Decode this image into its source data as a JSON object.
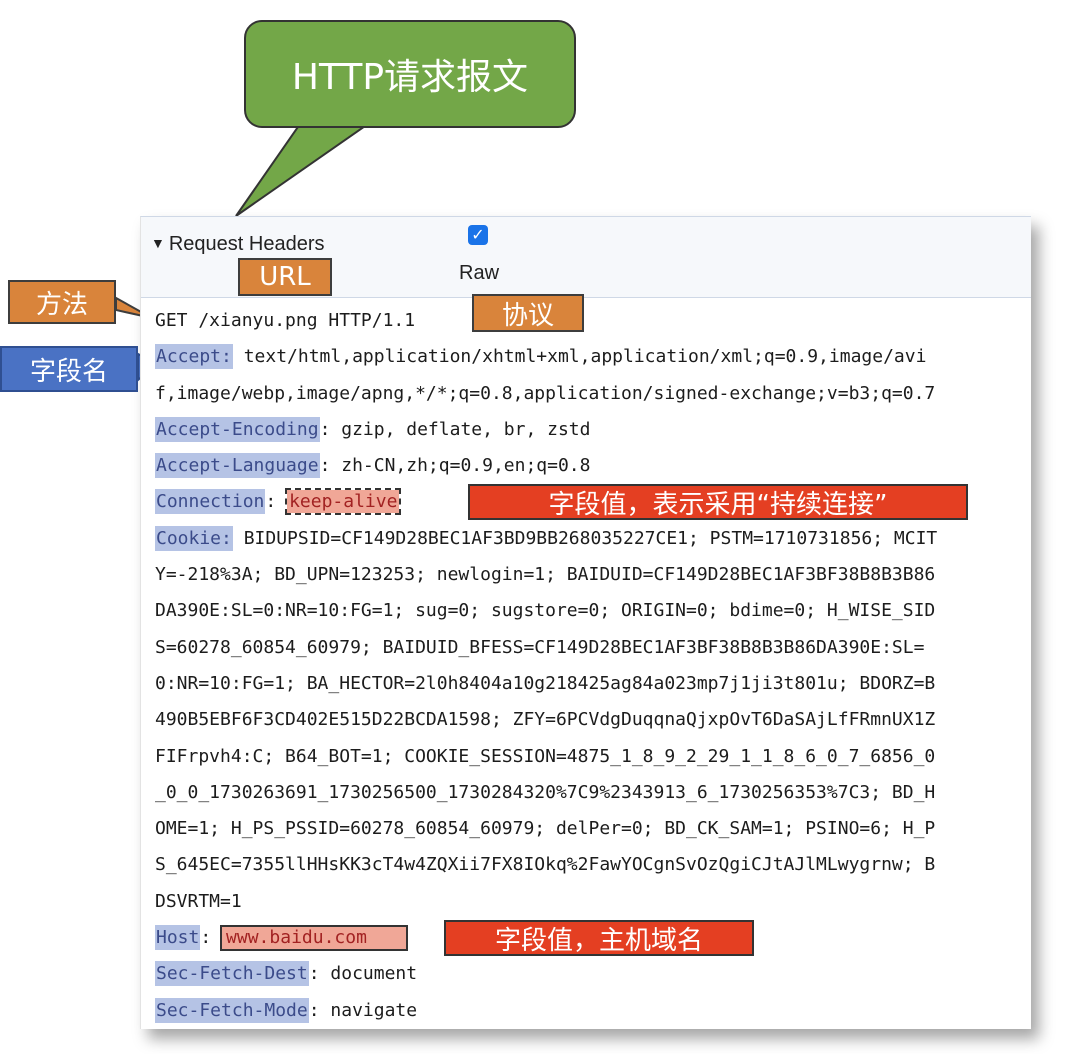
{
  "title_callout": "HTTP请求报文",
  "panel": {
    "section_label": "Request Headers",
    "raw_label": "Raw",
    "raw_checked": true
  },
  "request_line": "GET /xianyu.png HTTP/1.1",
  "headers": {
    "accept_name": "Accept:",
    "accept_value_1": " text/html,application/xhtml+xml,application/xml;q=0.9,image/avi",
    "accept_value_2": "f,image/webp,image/apng,*/*;q=0.8,application/signed-exchange;v=b3;q=0.7",
    "encoding_name": "Accept-Encoding",
    "encoding_value": ": gzip, deflate, br, zstd",
    "language_name": "Accept-Language",
    "language_value": ": zh-CN,zh;q=0.9,en;q=0.8",
    "connection_name": "Connection",
    "connection_sep": ": ",
    "connection_value": "keep-alive",
    "cookie_name": "Cookie:",
    "cookie_lines": [
      " BIDUPSID=CF149D28BEC1AF3BD9BB268035227CE1; PSTM=1710731856; MCIT",
      "Y=-218%3A; BD_UPN=123253; newlogin=1; BAIDUID=CF149D28BEC1AF3BF38B8B3B86",
      "DA390E:SL=0:NR=10:FG=1; sug=0; sugstore=0; ORIGIN=0; bdime=0; H_WISE_SID",
      "S=60278_60854_60979; BAIDUID_BFESS=CF149D28BEC1AF3BF38B8B3B86DA390E:SL=",
      "0:NR=10:FG=1; BA_HECTOR=2l0h8404a10g218425ag84a023mp7j1ji3t801u; BDORZ=B",
      "490B5EBF6F3CD402E515D22BCDA1598; ZFY=6PCVdgDuqqnaQjxpOvT6DaSAjLfFRmnUX1Z",
      "FIFrpvh4:C; B64_BOT=1; COOKIE_SESSION=4875_1_8_9_2_29_1_1_8_6_0_7_6856_0",
      "_0_0_1730263691_1730256500_1730284320%7C9%2343913_6_1730256353%7C3; BD_H",
      "OME=1; H_PS_PSSID=60278_60854_60979; delPer=0; BD_CK_SAM=1; PSINO=6; H_P",
      "S_645EC=7355llHHsKK3cT4w4ZQXii7FX8IOkq%2FawYOCgnSvOzQgiCJtAJlMLwygrnw; B",
      "DSVRTM=1"
    ],
    "host_name": "Host",
    "host_sep": ": ",
    "host_value": "www.baidu.com",
    "dest_name": "Sec-Fetch-Dest",
    "dest_value": ": document",
    "mode_name": "Sec-Fetch-Mode",
    "mode_value": ": navigate"
  },
  "annotations": {
    "method": "方法",
    "url": "URL",
    "protocol": "协议",
    "field_name": "字段名",
    "connection_note": "字段值，表示采用“持续连接”",
    "host_note": "字段值，主机域名"
  },
  "colors": {
    "callout_orange": "#d9843b",
    "callout_blue": "#4a72c4",
    "callout_red": "#e43f22",
    "callout_green": "#73a748",
    "header_name_bg": "#b5c3e5"
  }
}
